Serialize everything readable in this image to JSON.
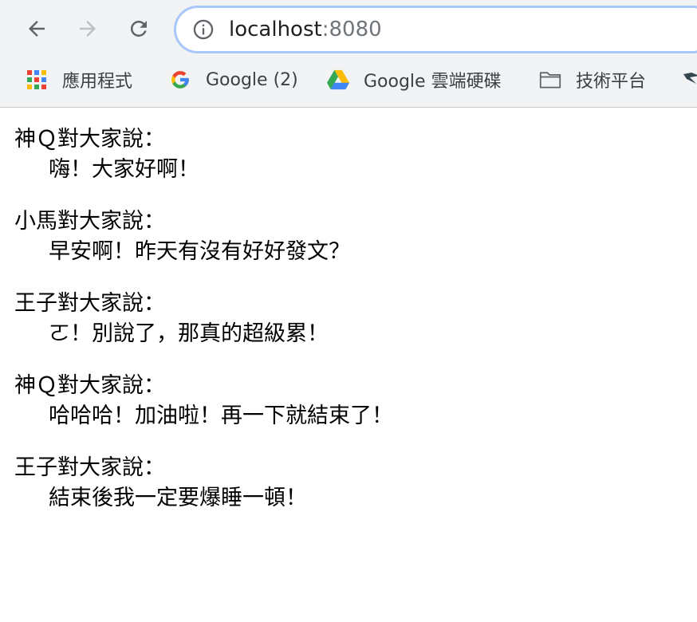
{
  "browser": {
    "address_bar": {
      "host": "localhost",
      "port": ":8080"
    },
    "bookmarks": [
      {
        "label": "應用程式",
        "icon": "apps-grid-icon"
      },
      {
        "label": "Google (2)",
        "icon": "google-g-icon"
      },
      {
        "label": "Google 雲端硬碟",
        "icon": "google-drive-icon"
      },
      {
        "label": "技術平台",
        "icon": "folder-icon"
      }
    ]
  },
  "messages": [
    {
      "speaker": "神Ｑ對大家說：",
      "text": "嗨！大家好啊！"
    },
    {
      "speaker": "小馬對大家說：",
      "text": "早安啊！昨天有沒有好好發文？"
    },
    {
      "speaker": "王子對大家說：",
      "text": "ㄛ！別說了，那真的超級累！"
    },
    {
      "speaker": "神Ｑ對大家說：",
      "text": "哈哈哈！加油啦！再一下就結束了！"
    },
    {
      "speaker": "王子對大家說：",
      "text": "結束後我一定要爆睡一頓！"
    }
  ]
}
